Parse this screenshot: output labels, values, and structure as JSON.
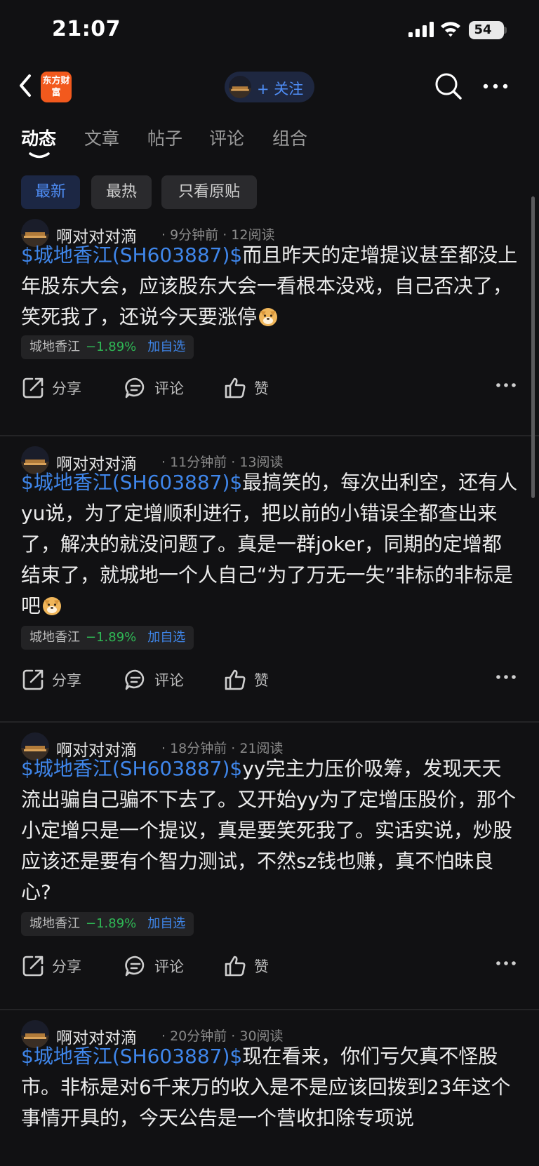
{
  "status_bar": {
    "time": "21:07",
    "battery": "54"
  },
  "nav": {
    "logo_text": "东方财富",
    "follow_label": "+ 关注"
  },
  "tabs": [
    {
      "label": "动态",
      "active": true
    },
    {
      "label": "文章"
    },
    {
      "label": "帖子"
    },
    {
      "label": "评论"
    },
    {
      "label": "组合"
    }
  ],
  "filters": [
    {
      "label": "最新",
      "active": true
    },
    {
      "label": "最热"
    },
    {
      "label": "只看原贴"
    }
  ],
  "posts": [
    {
      "author": "啊对对对滴",
      "meta": "· 9分钟前 · 12阅读",
      "stock_link": "$城地香江(SH603887)$",
      "text": "而且昨天的定增提议甚至都没上年股东大会，应该股东大会一看根本没戏，自己否决了，笑死我了，还说今天要涨停",
      "emoji": "doge-emoji",
      "tag": {
        "name": "城地香江",
        "change": "−1.89%",
        "add": "加自选"
      },
      "actions": {
        "share": "分享",
        "comment": "评论",
        "like": "赞"
      }
    },
    {
      "author": "啊对对对滴",
      "meta": "· 11分钟前 · 13阅读",
      "stock_link": "$城地香江(SH603887)$",
      "text": "最搞笑的，每次出利空，还有人yu说，为了定增顺利进行，把以前的小错误全都查出来了，解决的就没问题了。真是一群joker，同期的定增都结束了，就城地一个人自己“为了万无一失”非标的非标是吧",
      "emoji": "doge-emoji",
      "tag": {
        "name": "城地香江",
        "change": "−1.89%",
        "add": "加自选"
      },
      "actions": {
        "share": "分享",
        "comment": "评论",
        "like": "赞"
      }
    },
    {
      "author": "啊对对对滴",
      "meta": "· 18分钟前 · 21阅读",
      "stock_link": "$城地香江(SH603887)$",
      "text": "yy完主力压价吸筹，发现天天流出骗自己骗不下去了。又开始yy为了定增压股价，那个小定增只是一个提议，真是要笑死我了。实话实说，炒股应该还是要有个智力测试，不然sz钱也赚，真不怕昧良心?",
      "tag": {
        "name": "城地香江",
        "change": "−1.89%",
        "add": "加自选"
      },
      "actions": {
        "share": "分享",
        "comment": "评论",
        "like": "赞"
      }
    },
    {
      "author": "啊对对对滴",
      "meta": "· 20分钟前 · 30阅读",
      "stock_link": "$城地香江(SH603887)$",
      "text": "现在看来，你们亏欠真不怪股市。非标是对6千来万的收入是不是应该回拨到23年这个事情开具的，今天公告是一个营收扣除专项说"
    }
  ]
}
